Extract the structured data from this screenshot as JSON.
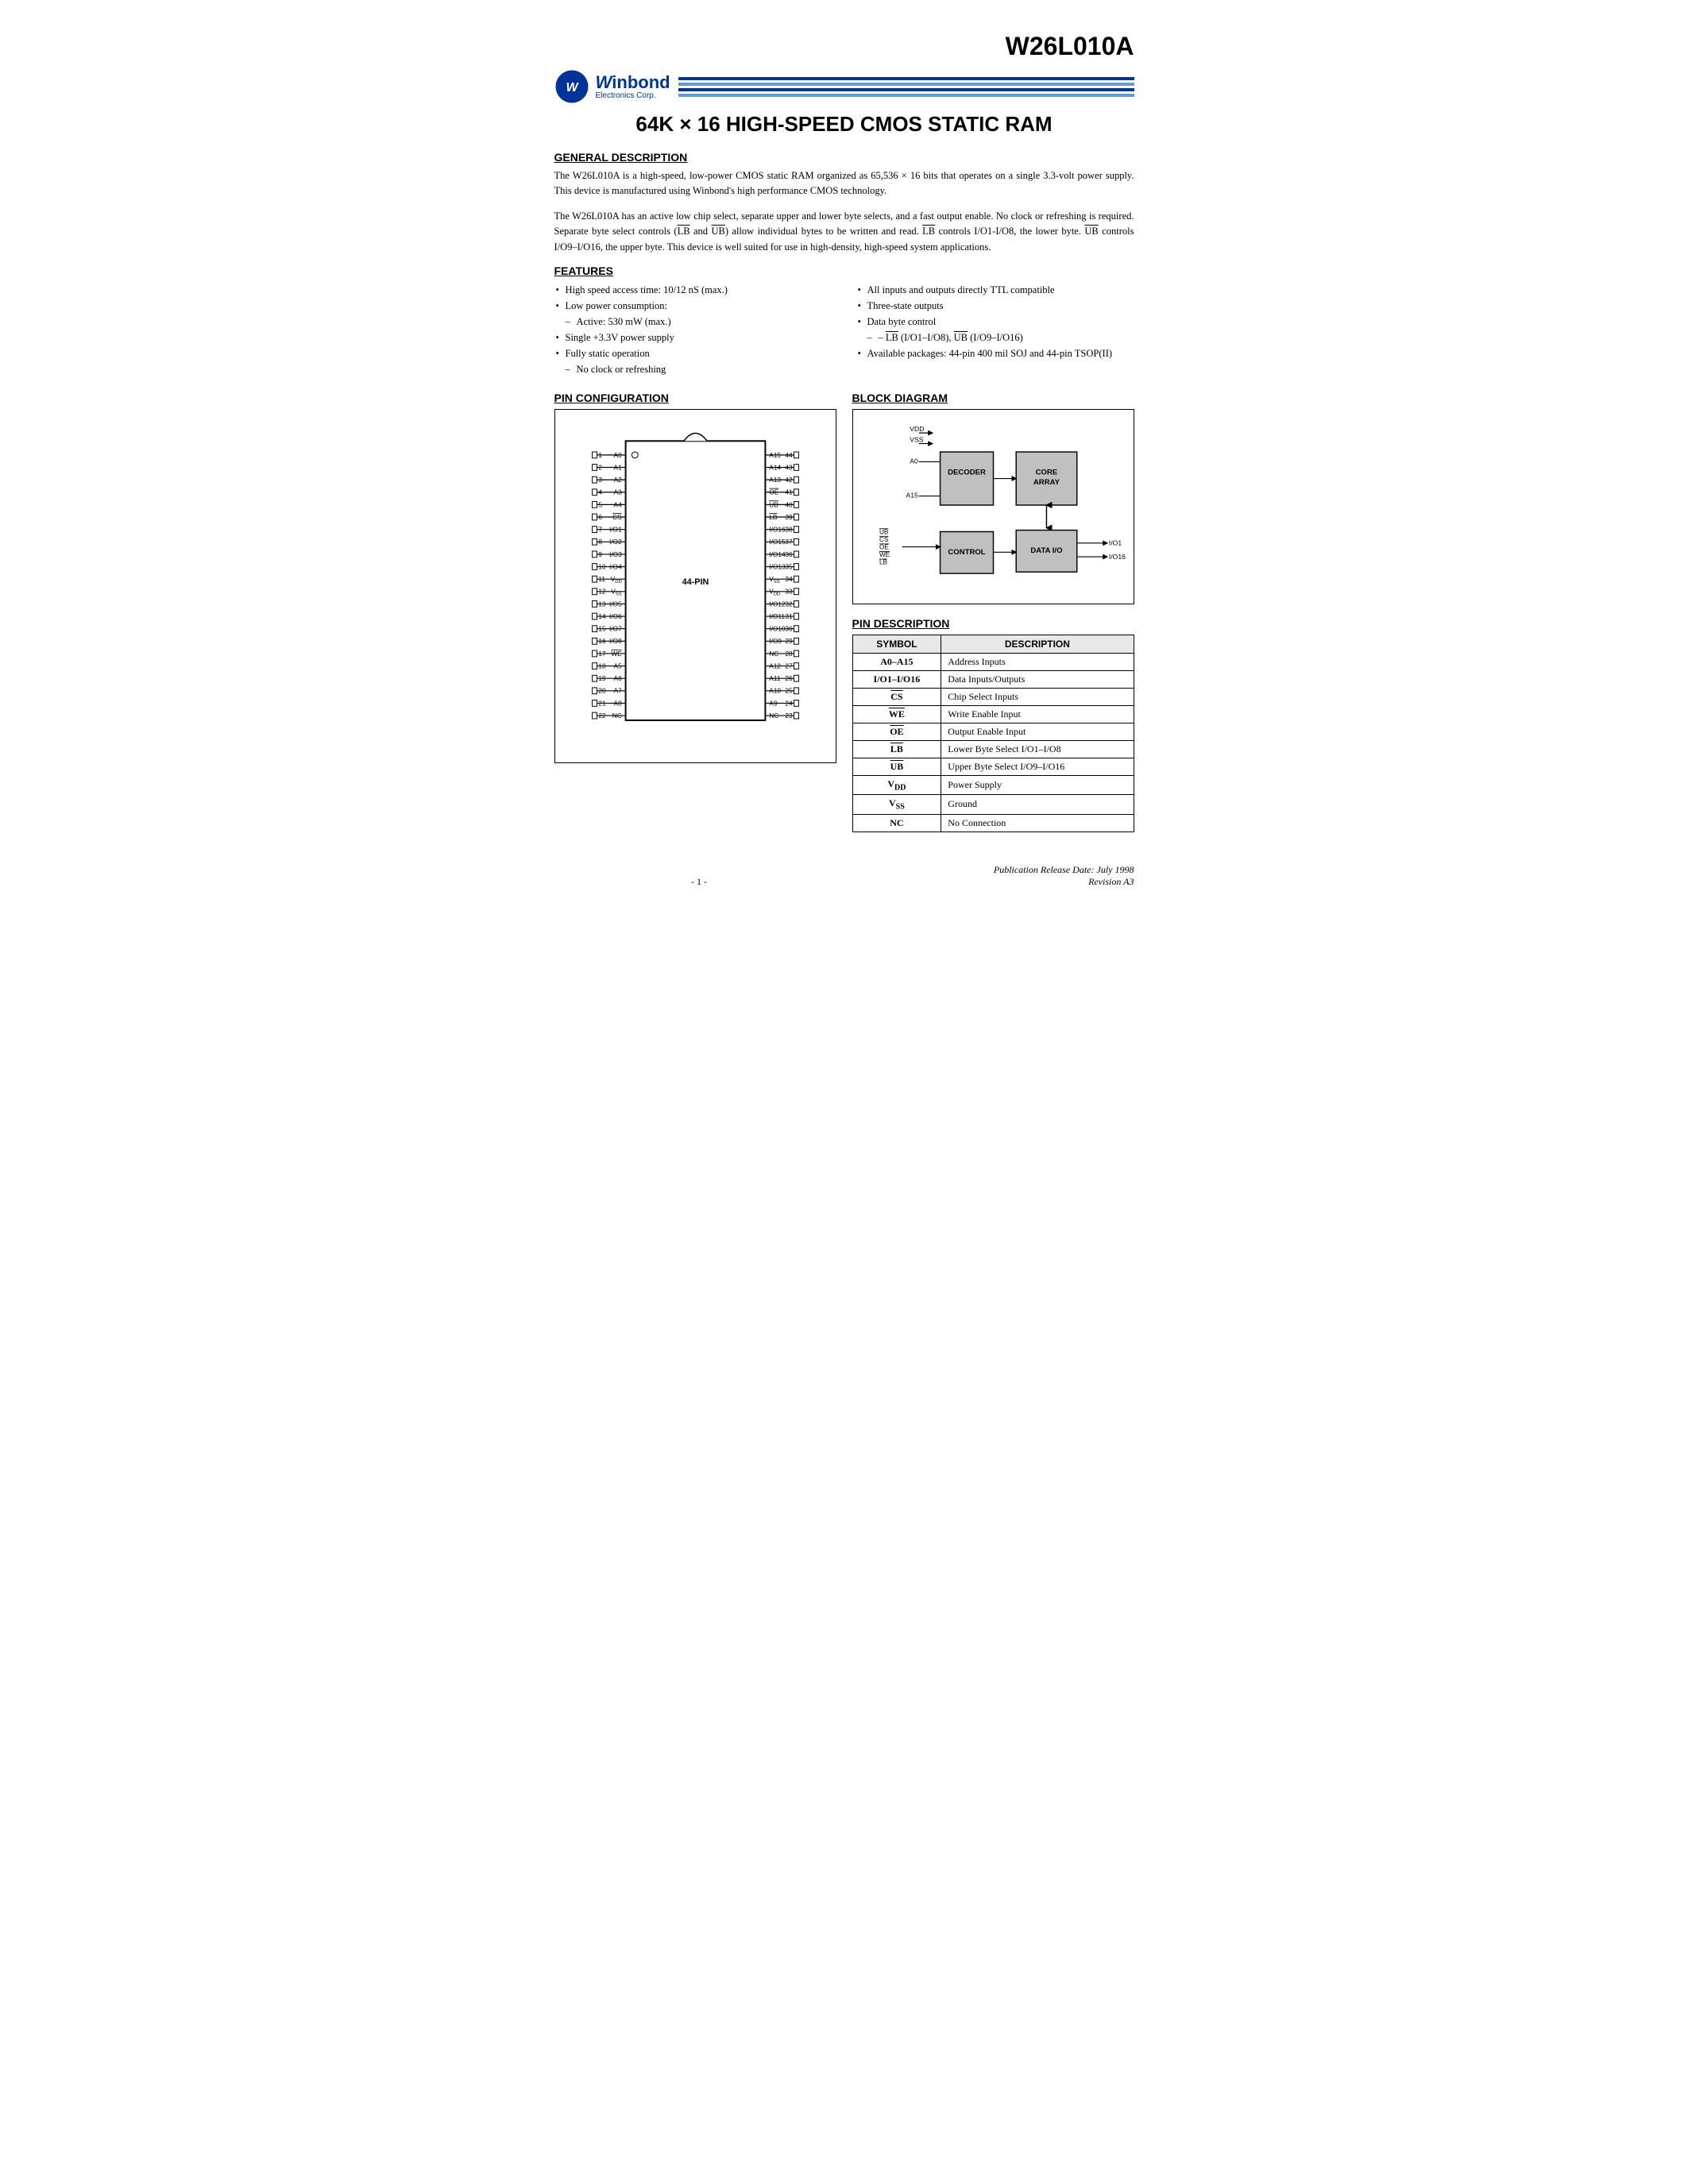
{
  "header": {
    "part_number": "W26L010A",
    "logo_brand": "inbond",
    "logo_w": "W",
    "logo_sub": "Electronics Corp.",
    "main_title": "64K × 16 HIGH-SPEED CMOS STATIC RAM"
  },
  "general_description": {
    "title": "GENERAL DESCRIPTION",
    "para1": "The W26L010A is a high-speed, low-power CMOS static RAM organized as 65,536 × 16 bits that operates on a single 3.3-volt power supply. This device is manufactured using Winbond's high performance CMOS technology.",
    "para2": "The W26L010A has an active low chip select, separate upper and lower byte selects, and a fast output enable. No clock or refreshing is required. Separate byte select controls (LB and UB) allow individual bytes to be written and read. LB controls I/O1-I/O8, the lower byte. UB controls I/O9–I/O16, the upper byte. This device is well suited for use in high-density, high-speed system applications."
  },
  "features": {
    "title": "FEATURES",
    "col1": [
      {
        "text": "High speed access time: 10/12 nS (max.)",
        "type": "bullet"
      },
      {
        "text": "Low power consumption:",
        "type": "bullet"
      },
      {
        "text": "Active: 530 mW (max.)",
        "type": "sub"
      },
      {
        "text": "Single +3.3V power supply",
        "type": "bullet"
      },
      {
        "text": "Fully static operation",
        "type": "bullet"
      },
      {
        "text": "No clock or refreshing",
        "type": "sub"
      }
    ],
    "col2": [
      {
        "text": "All inputs and outputs directly TTL compatible",
        "type": "bullet"
      },
      {
        "text": "Three-state outputs",
        "type": "bullet"
      },
      {
        "text": "Data byte control",
        "type": "bullet"
      },
      {
        "text": "LB (I/O1–I/O8), UB (I/O9–I/O16)",
        "type": "sub"
      },
      {
        "text": "Available packages: 44-pin 400 mil SOJ and 44-pin TSOP(II)",
        "type": "bullet"
      }
    ]
  },
  "pin_config": {
    "title": "PIN CONFIGURATION",
    "label": "44-PIN"
  },
  "block_diagram": {
    "title": "BLOCK DIAGRAM",
    "blocks": [
      "DECODER",
      "CORE ARRAY",
      "CONTROL",
      "DATA I/O"
    ],
    "signals_left": [
      "VDD",
      "VSS",
      "A0",
      "A15"
    ],
    "signals_control": [
      "UB",
      "CS",
      "OE",
      "WE",
      "LB"
    ],
    "signals_right": [
      "I/O1",
      "I/O16"
    ]
  },
  "pin_description": {
    "title": "PIN DESCRIPTION",
    "headers": [
      "SYMBOL",
      "DESCRIPTION"
    ],
    "rows": [
      {
        "symbol": "A0–A15",
        "description": "Address Inputs"
      },
      {
        "symbol": "I/O1–I/O16",
        "description": "Data Inputs/Outputs"
      },
      {
        "symbol": "CS",
        "description": "Chip Select Inputs",
        "overline": true
      },
      {
        "symbol": "WE",
        "description": "Write Enable Input",
        "overline": true
      },
      {
        "symbol": "OE",
        "description": "Output Enable Input",
        "overline": true
      },
      {
        "symbol": "LB",
        "description": "Lower Byte Select I/O1–I/O8",
        "overline": true
      },
      {
        "symbol": "UB",
        "description": "Upper Byte Select I/O9–I/O16",
        "overline": true
      },
      {
        "symbol": "VDD",
        "description": "Power Supply",
        "sub": "DD"
      },
      {
        "symbol": "VSS",
        "description": "Ground",
        "sub": "SS"
      },
      {
        "symbol": "NC",
        "description": "No Connection"
      }
    ]
  },
  "footer": {
    "publication": "Publication Release Date: July 1998",
    "revision": "Revision A3",
    "page": "- 1 -"
  }
}
